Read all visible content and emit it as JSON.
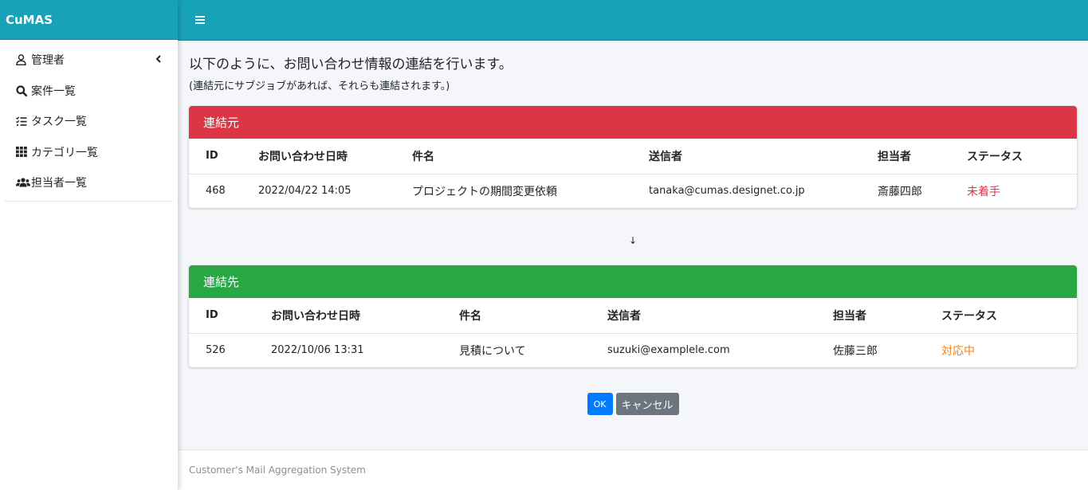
{
  "brand": "CuMAS",
  "sidebar": {
    "items": [
      {
        "label": "管理者",
        "icon": "user-icon",
        "has_chevron": true
      },
      {
        "label": "案件一覧",
        "icon": "search-icon"
      },
      {
        "label": "タスク一覧",
        "icon": "list-check-icon"
      },
      {
        "label": "カテゴリ一覧",
        "icon": "grid-icon"
      },
      {
        "label": "担当者一覧",
        "icon": "users-icon"
      }
    ]
  },
  "header": {
    "menu_icon": "hamburger-icon"
  },
  "intro": {
    "title": "以下のように、お問い合わせ情報の連結を行います。",
    "subtitle": "(連結元にサブジョブがあれば、それらも連結されます。)"
  },
  "source": {
    "title": "連結元",
    "color": "#dc3545",
    "columns": [
      "ID",
      "お問い合わせ日時",
      "件名",
      "送信者",
      "担当者",
      "ステータス"
    ],
    "row": {
      "id": "468",
      "datetime": "2022/04/22 14:05",
      "subject": "プロジェクトの期間変更依頼",
      "sender": "tanaka@cumas.designet.co.jp",
      "assignee": "斎藤四郎",
      "status": "未着手",
      "status_color": "#dc3545"
    }
  },
  "arrow": "↓",
  "target": {
    "title": "連結先",
    "color": "#28a745",
    "columns": [
      "ID",
      "お問い合わせ日時",
      "件名",
      "送信者",
      "担当者",
      "ステータス"
    ],
    "row": {
      "id": "526",
      "datetime": "2022/10/06 13:31",
      "subject": "見積について",
      "sender": "suzuki@examplele.com",
      "assignee": "佐藤三郎",
      "status": "対応中",
      "status_color": "#fd7e14"
    }
  },
  "buttons": {
    "ok": "OK",
    "cancel": "キャンセル"
  },
  "footer": "Customer's Mail Aggregation System",
  "colors": {
    "accent": "#17a2b8",
    "primary": "#007bff",
    "secondary": "#6c757d"
  }
}
